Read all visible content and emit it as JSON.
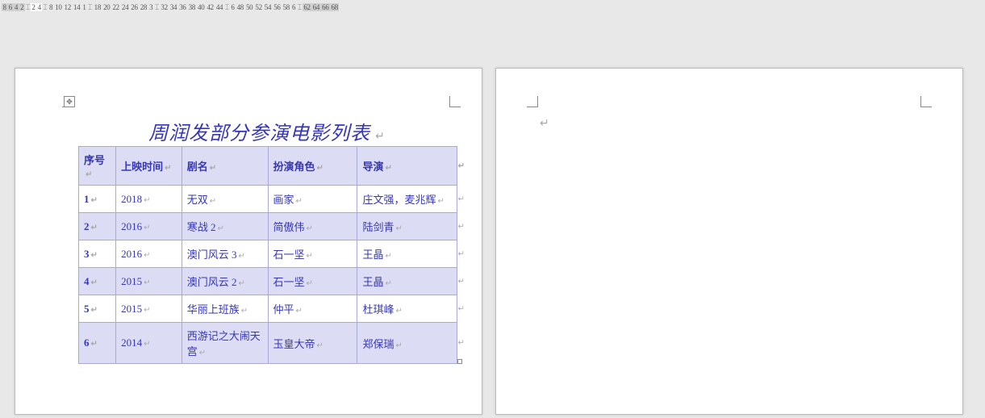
{
  "ruler": {
    "segments": [
      {
        "shade": true,
        "nums": [
          "8",
          "6",
          "4",
          "2"
        ]
      },
      {
        "tab": true
      },
      {
        "shade": false,
        "nums": [
          "2",
          "4"
        ]
      },
      {
        "tab": true
      },
      {
        "shade": false,
        "nums": [
          "8",
          "10",
          "12",
          "14",
          "1"
        ]
      },
      {
        "tab": true
      },
      {
        "shade": false,
        "nums": [
          "18",
          "20",
          "22",
          "24",
          "26",
          "28",
          "3"
        ]
      },
      {
        "tab": true
      },
      {
        "shade": false,
        "nums": [
          "32",
          "34",
          "36",
          "38",
          "40",
          "42",
          "44"
        ]
      },
      {
        "tab": true
      },
      {
        "shade": false,
        "nums": [
          "6",
          "48",
          "50",
          "52",
          "54",
          "56",
          "58",
          "6"
        ]
      },
      {
        "tab": true
      },
      {
        "shade": true,
        "nums": [
          "62",
          "64",
          "66",
          "68"
        ]
      }
    ]
  },
  "title": "周润发部分参演电影列表",
  "para_mark": "↵",
  "cell_mark": "↵",
  "row_end_mark": "↵",
  "table": {
    "headers": [
      "序号",
      "上映时间",
      "剧名",
      "扮演角色",
      "导演"
    ],
    "rows": [
      {
        "idx": "1",
        "year": "2018",
        "name": "无双",
        "role": "画家",
        "director": "庄文强，麦兆辉"
      },
      {
        "idx": "2",
        "year": "2016",
        "name": "寒战 2",
        "role": "简傲伟",
        "director": "陆剑青"
      },
      {
        "idx": "3",
        "year": "2016",
        "name": "澳门风云 3",
        "role": "石一坚",
        "director": "王晶"
      },
      {
        "idx": "4",
        "year": "2015",
        "name": "澳门风云 2",
        "role": "石一坚",
        "director": "王晶"
      },
      {
        "idx": "5",
        "year": "2015",
        "name": "华丽上班族",
        "role": "仲平",
        "director": "杜琪峰"
      },
      {
        "idx": "6",
        "year": "2014",
        "name": "西游记之大闹天宫",
        "role": "玉皇大帝",
        "director": "郑保瑞"
      }
    ]
  }
}
